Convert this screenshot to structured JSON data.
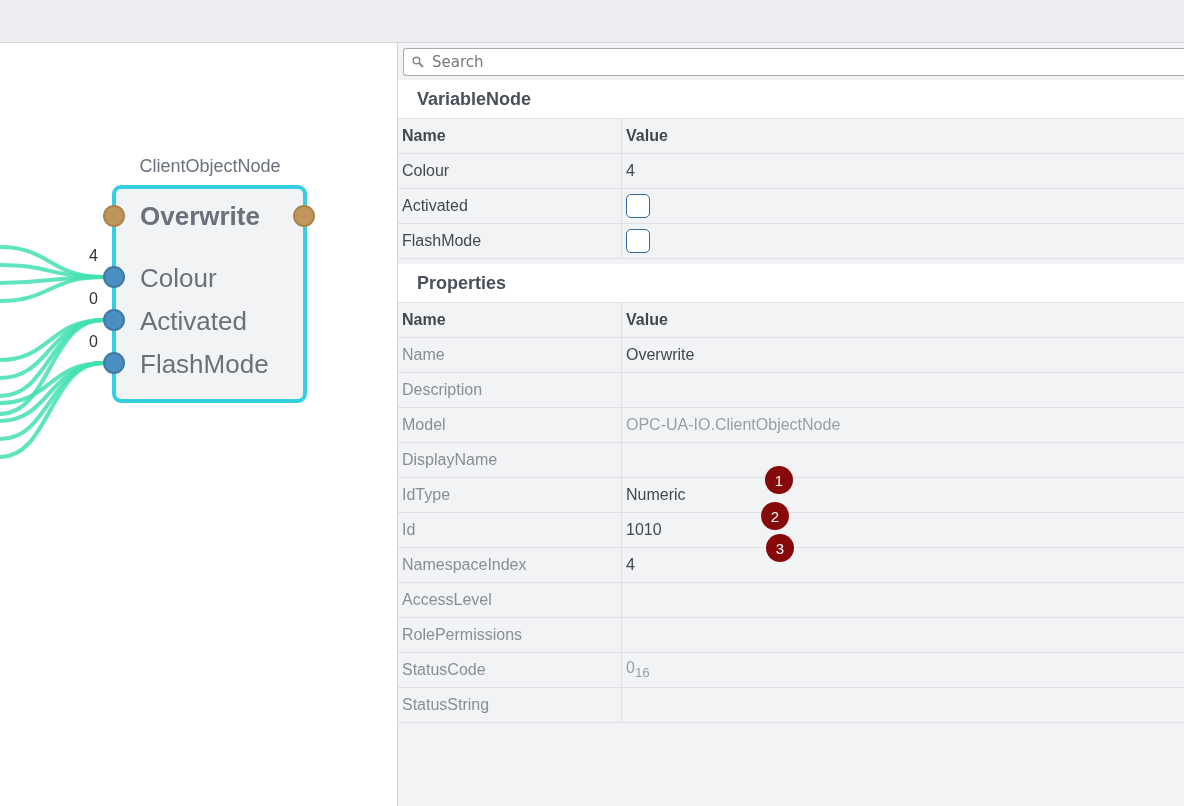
{
  "node": {
    "caption": "ClientObjectNode",
    "title": "Overwrite",
    "inputs": [
      {
        "name": "Colour",
        "value": "4"
      },
      {
        "name": "Activated",
        "value": "0"
      },
      {
        "name": "FlashMode",
        "value": "0"
      }
    ]
  },
  "search": {
    "placeholder": "Search"
  },
  "sections": [
    {
      "title": "VariableNode",
      "columns": [
        "Name",
        "Value"
      ],
      "rows": [
        {
          "name": "Colour",
          "kind": "text",
          "value": "4"
        },
        {
          "name": "Activated",
          "kind": "checkbox",
          "checked": false
        },
        {
          "name": "FlashMode",
          "kind": "checkbox",
          "checked": false
        }
      ]
    },
    {
      "title": "Properties",
      "columns": [
        "Name",
        "Value"
      ],
      "rows": [
        {
          "name": "Name",
          "kind": "text",
          "value": "Overwrite",
          "readonly": false
        },
        {
          "name": "Description",
          "kind": "text"
        },
        {
          "name": "Model",
          "kind": "text",
          "value": "OPC-UA-IO.ClientObjectNode",
          "readonly": true
        },
        {
          "name": "DisplayName",
          "kind": "text"
        },
        {
          "name": "IdType",
          "kind": "text",
          "value": "Numeric",
          "readonly": false
        },
        {
          "name": "Id",
          "kind": "text",
          "value": "1010",
          "readonly": false
        },
        {
          "name": "NamespaceIndex",
          "kind": "text",
          "value": "4",
          "readonly": false
        },
        {
          "name": "AccessLevel",
          "kind": "text"
        },
        {
          "name": "RolePermissions",
          "kind": "text"
        },
        {
          "name": "StatusCode",
          "kind": "text",
          "value": "0$_{16}$",
          "readonly": true
        },
        {
          "name": "StatusString",
          "kind": "text"
        }
      ]
    }
  ],
  "markers": [
    "1",
    "2",
    "3"
  ]
}
